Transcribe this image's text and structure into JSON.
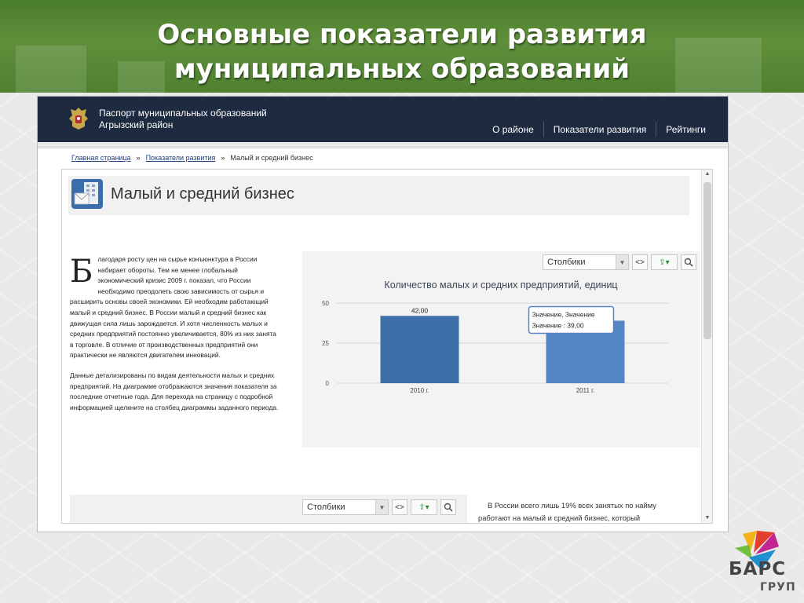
{
  "slide": {
    "title_line1": "Основные показатели развития",
    "title_line2": "муниципальных образований"
  },
  "site": {
    "title_line1": "Паспорт муниципальных образований",
    "title_line2": "Агрызский район",
    "nav": [
      "О районе",
      "Показатели развития",
      "Рейтинги"
    ]
  },
  "breadcrumb": {
    "items": [
      "Главная страница",
      "Показатели развития"
    ],
    "separator": "»",
    "current": "Малый и средний бизнес"
  },
  "page": {
    "heading": "Малый и средний бизнес",
    "dropcap": "Б",
    "intro_p1": "лагодаря росту цен на сырье конъюнктура в России набирает обороты. Тем не менее глобальный экономический кризис 2009 г. показал, что России необходимо преодолеть свою зависимость от сырья и расширить основы своей экономики. Ей необходим работающий малый и средний бизнес. В России малый и средний бизнес как движущая сила лишь зарождается. И хотя численность малых и средних предприятий постоянно увеличивается, 80% из них занята в торговле. В отличие от производственных предприятий они практически не являются двигателем инноваций.",
    "intro_p2": "Данные детализированы по видам деятельности малых и средних предприятий. На диаграмме отображаются значения показателя за последние отчетные года. Для перехода на страницу с подробной информацией щелкните на столбец диаграммы заданного периода.",
    "right_text": "В России всего лишь 19% всех занятых по найму работают на малый и средний бизнес, который"
  },
  "toolbar": {
    "chart_type": "Столбики",
    "dropdown_arrow": "▼",
    "code_btn": "<>",
    "export_btn": "⇪▾",
    "search_btn": "🔍"
  },
  "tooltip": {
    "line1": "Значение, Значение",
    "line2": "Значение :  39,00"
  },
  "chart_data": {
    "type": "bar",
    "title": "Количество малых и средних предприятий, единиц",
    "categories": [
      "2010 г.",
      "2011 г."
    ],
    "values": [
      42.0,
      39.0
    ],
    "data_labels": [
      "42,00",
      "39,00"
    ],
    "ylim": [
      0,
      50
    ],
    "yticks": [
      0,
      25,
      50
    ],
    "ytick_labels": [
      "0",
      "25",
      "50"
    ],
    "grid": true,
    "bar_colors": [
      "#3f6fa8",
      "#5585c2"
    ]
  },
  "logo": {
    "text": "БАРС",
    "sub": "ГРУП",
    "mark": "®"
  }
}
